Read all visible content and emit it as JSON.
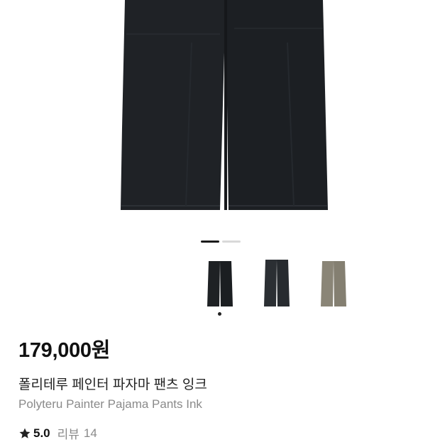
{
  "product": {
    "price": "179,000원",
    "name_ko": "폴리테루 페인터 파자마 팬츠 잉크",
    "name_en": "Polyteru Painter Pajama Pants Ink",
    "rating": "5.0",
    "review_label": "리뷰",
    "review_count": "14"
  },
  "gallery": {
    "pager_pages": 2,
    "current_page": 1,
    "selected_thumbnail": 1,
    "thumbnails": [
      {
        "color_hex": "#1e2124"
      },
      {
        "color_hex": "#2b2f33"
      },
      {
        "color_hex": "#8a8577"
      }
    ]
  },
  "colors": {
    "pants_main": "#1f2226",
    "star": "#222222"
  }
}
